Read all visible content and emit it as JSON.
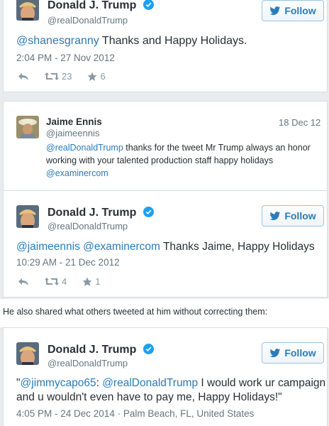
{
  "tweet1": {
    "name": "Donald J. Trump",
    "handle": "@realDonaldTrump",
    "follow_label": "Follow",
    "mention": "@shanesgranny",
    "text": " Thanks and Happy Holidays.",
    "timestamp": "2:04 PM - 27 Nov 2012",
    "retweets": "23",
    "favorites": "6"
  },
  "tweet2": {
    "name": "Jaime Ennis",
    "handle": "@jaimeennis",
    "date": "18 Dec 12",
    "mention": "@realDonaldTrump",
    "text": " thanks for the tweet Mr Trump always an honor working with your talented production staff happy holidays ",
    "mention2": "@examinercom"
  },
  "tweet3": {
    "name": "Donald J. Trump",
    "handle": "@realDonaldTrump",
    "follow_label": "Follow",
    "mention1": "@jaimeennis",
    "mention2": "@examinercom",
    "text": "  Thanks Jaime, Happy Holidays",
    "timestamp": "10:29 AM - 21 Dec 2012",
    "retweets": "4",
    "favorites": "1"
  },
  "caption": "He also shared what others tweeted at him without correcting them:",
  "tweet4": {
    "name": "Donald J. Trump",
    "handle": "@realDonaldTrump",
    "follow_label": "Follow",
    "quote_open": "\"",
    "mention1": "@jimmycapo65",
    "colon": ": ",
    "mention2": "@realDonaldTrump",
    "text": " I would work ur campaign and u wouldn't even have to pay me, Happy Holidays!\"",
    "timestamp": "4:05 PM - 24 Dec 2014",
    "location": " · Palm Beach, FL, United States"
  },
  "colors": {
    "link": "#2b7bb9",
    "muted": "#66757f",
    "verified": "#1da1f2"
  }
}
